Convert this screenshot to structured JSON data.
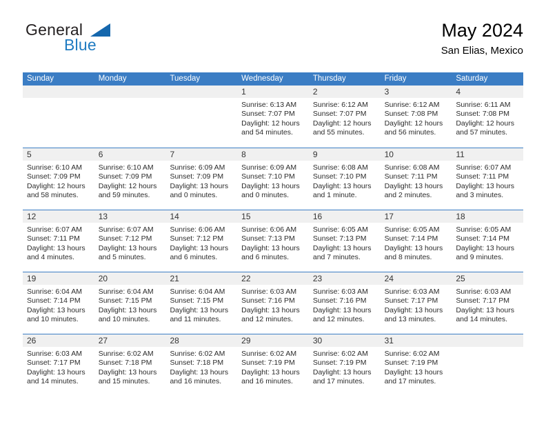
{
  "brand": {
    "name_part1": "General",
    "name_part2": "Blue",
    "accent_color": "#1567ad"
  },
  "header": {
    "title": "May 2024",
    "subtitle": "San Elias, Mexico",
    "header_bg_color": "#3b7dc4"
  },
  "weekdays": [
    {
      "label": "Sunday"
    },
    {
      "label": "Monday"
    },
    {
      "label": "Tuesday"
    },
    {
      "label": "Wednesday"
    },
    {
      "label": "Thursday"
    },
    {
      "label": "Friday"
    },
    {
      "label": "Saturday"
    }
  ],
  "weeks": [
    {
      "days": [
        {
          "number": "",
          "sunrise": "",
          "sunset": "",
          "daylight_line1": "",
          "daylight_line2": "",
          "empty": true
        },
        {
          "number": "",
          "sunrise": "",
          "sunset": "",
          "daylight_line1": "",
          "daylight_line2": "",
          "empty": true
        },
        {
          "number": "",
          "sunrise": "",
          "sunset": "",
          "daylight_line1": "",
          "daylight_line2": "",
          "empty": true
        },
        {
          "number": "1",
          "sunrise": "Sunrise: 6:13 AM",
          "sunset": "Sunset: 7:07 PM",
          "daylight_line1": "Daylight: 12 hours",
          "daylight_line2": "and 54 minutes.",
          "empty": false
        },
        {
          "number": "2",
          "sunrise": "Sunrise: 6:12 AM",
          "sunset": "Sunset: 7:07 PM",
          "daylight_line1": "Daylight: 12 hours",
          "daylight_line2": "and 55 minutes.",
          "empty": false
        },
        {
          "number": "3",
          "sunrise": "Sunrise: 6:12 AM",
          "sunset": "Sunset: 7:08 PM",
          "daylight_line1": "Daylight: 12 hours",
          "daylight_line2": "and 56 minutes.",
          "empty": false
        },
        {
          "number": "4",
          "sunrise": "Sunrise: 6:11 AM",
          "sunset": "Sunset: 7:08 PM",
          "daylight_line1": "Daylight: 12 hours",
          "daylight_line2": "and 57 minutes.",
          "empty": false
        }
      ]
    },
    {
      "days": [
        {
          "number": "5",
          "sunrise": "Sunrise: 6:10 AM",
          "sunset": "Sunset: 7:09 PM",
          "daylight_line1": "Daylight: 12 hours",
          "daylight_line2": "and 58 minutes.",
          "empty": false
        },
        {
          "number": "6",
          "sunrise": "Sunrise: 6:10 AM",
          "sunset": "Sunset: 7:09 PM",
          "daylight_line1": "Daylight: 12 hours",
          "daylight_line2": "and 59 minutes.",
          "empty": false
        },
        {
          "number": "7",
          "sunrise": "Sunrise: 6:09 AM",
          "sunset": "Sunset: 7:09 PM",
          "daylight_line1": "Daylight: 13 hours",
          "daylight_line2": "and 0 minutes.",
          "empty": false
        },
        {
          "number": "8",
          "sunrise": "Sunrise: 6:09 AM",
          "sunset": "Sunset: 7:10 PM",
          "daylight_line1": "Daylight: 13 hours",
          "daylight_line2": "and 0 minutes.",
          "empty": false
        },
        {
          "number": "9",
          "sunrise": "Sunrise: 6:08 AM",
          "sunset": "Sunset: 7:10 PM",
          "daylight_line1": "Daylight: 13 hours",
          "daylight_line2": "and 1 minute.",
          "empty": false
        },
        {
          "number": "10",
          "sunrise": "Sunrise: 6:08 AM",
          "sunset": "Sunset: 7:11 PM",
          "daylight_line1": "Daylight: 13 hours",
          "daylight_line2": "and 2 minutes.",
          "empty": false
        },
        {
          "number": "11",
          "sunrise": "Sunrise: 6:07 AM",
          "sunset": "Sunset: 7:11 PM",
          "daylight_line1": "Daylight: 13 hours",
          "daylight_line2": "and 3 minutes.",
          "empty": false
        }
      ]
    },
    {
      "days": [
        {
          "number": "12",
          "sunrise": "Sunrise: 6:07 AM",
          "sunset": "Sunset: 7:11 PM",
          "daylight_line1": "Daylight: 13 hours",
          "daylight_line2": "and 4 minutes.",
          "empty": false
        },
        {
          "number": "13",
          "sunrise": "Sunrise: 6:07 AM",
          "sunset": "Sunset: 7:12 PM",
          "daylight_line1": "Daylight: 13 hours",
          "daylight_line2": "and 5 minutes.",
          "empty": false
        },
        {
          "number": "14",
          "sunrise": "Sunrise: 6:06 AM",
          "sunset": "Sunset: 7:12 PM",
          "daylight_line1": "Daylight: 13 hours",
          "daylight_line2": "and 6 minutes.",
          "empty": false
        },
        {
          "number": "15",
          "sunrise": "Sunrise: 6:06 AM",
          "sunset": "Sunset: 7:13 PM",
          "daylight_line1": "Daylight: 13 hours",
          "daylight_line2": "and 6 minutes.",
          "empty": false
        },
        {
          "number": "16",
          "sunrise": "Sunrise: 6:05 AM",
          "sunset": "Sunset: 7:13 PM",
          "daylight_line1": "Daylight: 13 hours",
          "daylight_line2": "and 7 minutes.",
          "empty": false
        },
        {
          "number": "17",
          "sunrise": "Sunrise: 6:05 AM",
          "sunset": "Sunset: 7:14 PM",
          "daylight_line1": "Daylight: 13 hours",
          "daylight_line2": "and 8 minutes.",
          "empty": false
        },
        {
          "number": "18",
          "sunrise": "Sunrise: 6:05 AM",
          "sunset": "Sunset: 7:14 PM",
          "daylight_line1": "Daylight: 13 hours",
          "daylight_line2": "and 9 minutes.",
          "empty": false
        }
      ]
    },
    {
      "days": [
        {
          "number": "19",
          "sunrise": "Sunrise: 6:04 AM",
          "sunset": "Sunset: 7:14 PM",
          "daylight_line1": "Daylight: 13 hours",
          "daylight_line2": "and 10 minutes.",
          "empty": false
        },
        {
          "number": "20",
          "sunrise": "Sunrise: 6:04 AM",
          "sunset": "Sunset: 7:15 PM",
          "daylight_line1": "Daylight: 13 hours",
          "daylight_line2": "and 10 minutes.",
          "empty": false
        },
        {
          "number": "21",
          "sunrise": "Sunrise: 6:04 AM",
          "sunset": "Sunset: 7:15 PM",
          "daylight_line1": "Daylight: 13 hours",
          "daylight_line2": "and 11 minutes.",
          "empty": false
        },
        {
          "number": "22",
          "sunrise": "Sunrise: 6:03 AM",
          "sunset": "Sunset: 7:16 PM",
          "daylight_line1": "Daylight: 13 hours",
          "daylight_line2": "and 12 minutes.",
          "empty": false
        },
        {
          "number": "23",
          "sunrise": "Sunrise: 6:03 AM",
          "sunset": "Sunset: 7:16 PM",
          "daylight_line1": "Daylight: 13 hours",
          "daylight_line2": "and 12 minutes.",
          "empty": false
        },
        {
          "number": "24",
          "sunrise": "Sunrise: 6:03 AM",
          "sunset": "Sunset: 7:17 PM",
          "daylight_line1": "Daylight: 13 hours",
          "daylight_line2": "and 13 minutes.",
          "empty": false
        },
        {
          "number": "25",
          "sunrise": "Sunrise: 6:03 AM",
          "sunset": "Sunset: 7:17 PM",
          "daylight_line1": "Daylight: 13 hours",
          "daylight_line2": "and 14 minutes.",
          "empty": false
        }
      ]
    },
    {
      "days": [
        {
          "number": "26",
          "sunrise": "Sunrise: 6:03 AM",
          "sunset": "Sunset: 7:17 PM",
          "daylight_line1": "Daylight: 13 hours",
          "daylight_line2": "and 14 minutes.",
          "empty": false
        },
        {
          "number": "27",
          "sunrise": "Sunrise: 6:02 AM",
          "sunset": "Sunset: 7:18 PM",
          "daylight_line1": "Daylight: 13 hours",
          "daylight_line2": "and 15 minutes.",
          "empty": false
        },
        {
          "number": "28",
          "sunrise": "Sunrise: 6:02 AM",
          "sunset": "Sunset: 7:18 PM",
          "daylight_line1": "Daylight: 13 hours",
          "daylight_line2": "and 16 minutes.",
          "empty": false
        },
        {
          "number": "29",
          "sunrise": "Sunrise: 6:02 AM",
          "sunset": "Sunset: 7:19 PM",
          "daylight_line1": "Daylight: 13 hours",
          "daylight_line2": "and 16 minutes.",
          "empty": false
        },
        {
          "number": "30",
          "sunrise": "Sunrise: 6:02 AM",
          "sunset": "Sunset: 7:19 PM",
          "daylight_line1": "Daylight: 13 hours",
          "daylight_line2": "and 17 minutes.",
          "empty": false
        },
        {
          "number": "31",
          "sunrise": "Sunrise: 6:02 AM",
          "sunset": "Sunset: 7:19 PM",
          "daylight_line1": "Daylight: 13 hours",
          "daylight_line2": "and 17 minutes.",
          "empty": false
        },
        {
          "number": "",
          "sunrise": "",
          "sunset": "",
          "daylight_line1": "",
          "daylight_line2": "",
          "empty": true
        }
      ]
    }
  ]
}
